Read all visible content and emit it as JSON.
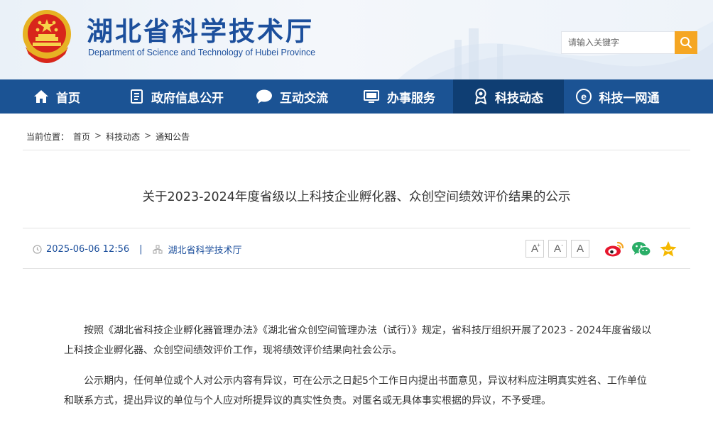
{
  "header": {
    "title": "湖北省科学技术厅",
    "subtitle": "Department of Science and Technology of Hubei Province",
    "search_placeholder": "请输入关键字"
  },
  "nav": {
    "items": [
      {
        "label": "首页",
        "icon": "home-icon"
      },
      {
        "label": "政府信息公开",
        "icon": "document-icon"
      },
      {
        "label": "互动交流",
        "icon": "chat-bubble-icon"
      },
      {
        "label": "办事服务",
        "icon": "monitor-icon"
      },
      {
        "label": "科技动态",
        "icon": "award-icon",
        "active": true
      },
      {
        "label": "科技一网通",
        "icon": "network-e-icon"
      }
    ]
  },
  "breadcrumb": {
    "prefix": "当前位置：",
    "items": [
      "首页",
      "科技动态",
      "通知公告"
    ],
    "separator": ">"
  },
  "article": {
    "title": "关于2023-2024年度省级以上科技企业孵化器、众创空间绩效评价结果的公示",
    "date": "2025-06-06 12:56",
    "divider": "|",
    "source": "湖北省科学技术厅",
    "font_sizes": {
      "large": "A",
      "medium": "A",
      "small": "A",
      "plus": "+",
      "minus": "-"
    },
    "paragraphs": [
      "按照《湖北省科技企业孵化器管理办法》《湖北省众创空间管理办法（试行）》规定，省科技厅组织开展了2023 - 2024年度省级以上科技企业孵化器、众创空间绩效评价工作，现将绩效评价结果向社会公示。",
      "公示期内，任何单位或个人对公示内容有异议，可在公示之日起5个工作日内提出书面意见，异议材料应注明真实姓名、工作单位和联系方式，提出异议的单位与个人应对所提异议的真实性负责。对匿名或无具体事实根据的异议，不予受理。"
    ]
  },
  "colors": {
    "brand_blue": "#1b5394",
    "nav_active": "#0f3e73",
    "search_orange": "#f5a623",
    "title_blue": "#1c4f9c"
  }
}
